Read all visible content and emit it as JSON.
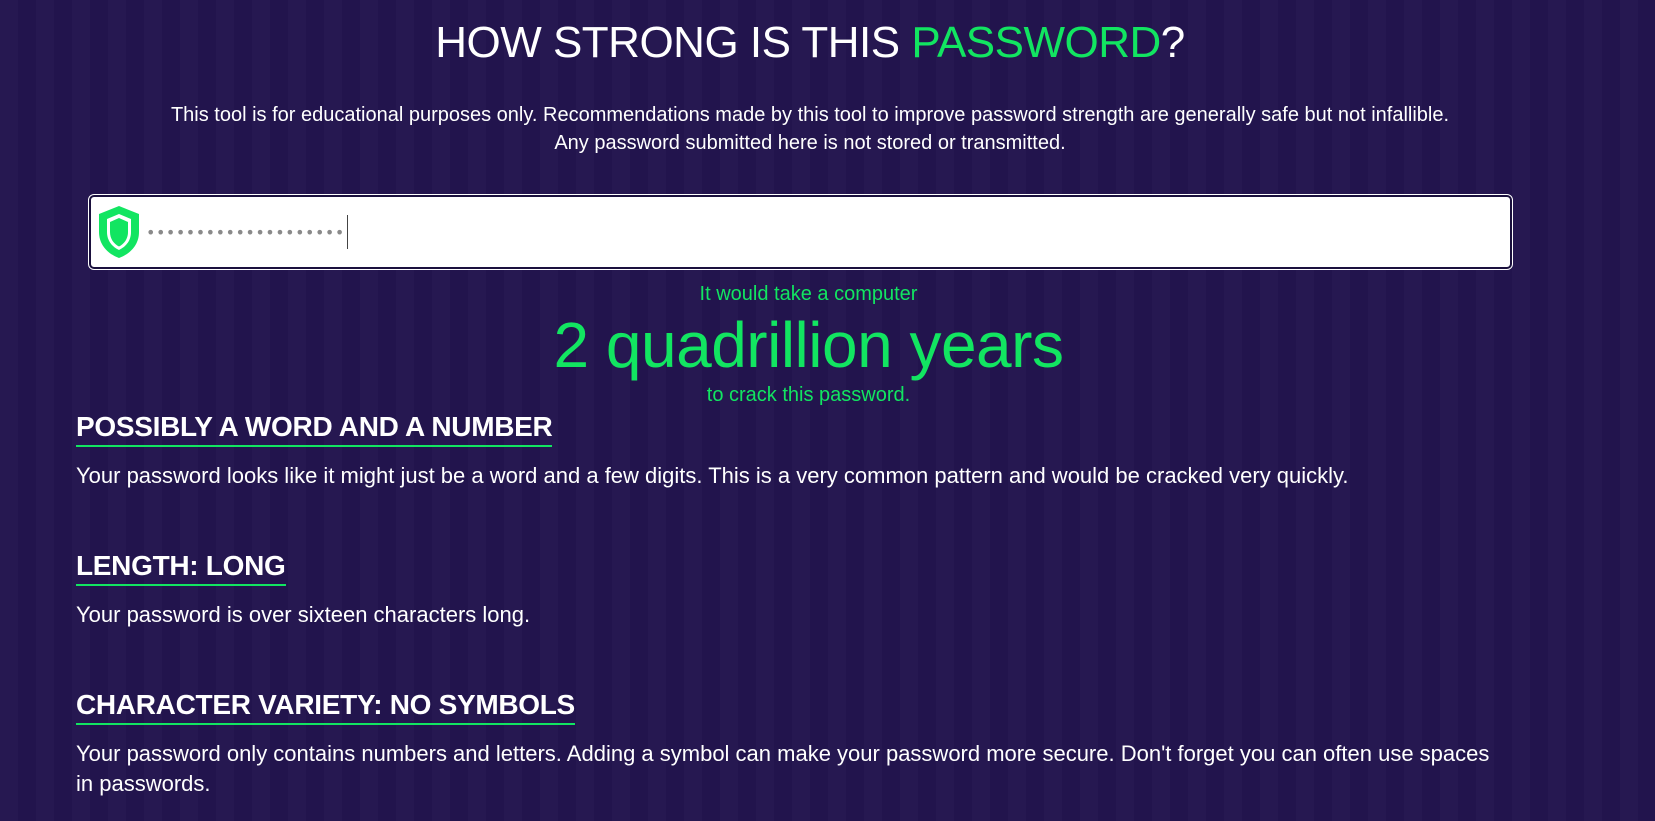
{
  "header": {
    "title_prefix": "HOW STRONG IS THIS ",
    "title_accent": "PASSWORD",
    "title_suffix": "?",
    "disclaimer_line1": "This tool is for educational purposes only. Recommendations made by this tool to improve password strength are generally safe but not infallible.",
    "disclaimer_line2": "Any password submitted here is not stored or transmitted."
  },
  "password_input": {
    "masked_value": "••••••••••••••••••••",
    "icon": "shield-icon"
  },
  "result": {
    "pre_text": "It would take a computer",
    "time": "2 quadrillion years",
    "post_text": "to crack this password."
  },
  "sections": [
    {
      "heading": "POSSIBLY A WORD AND A NUMBER",
      "body": "Your password looks like it might just be a word and a few digits. This is a very common pattern and would be cracked very quickly."
    },
    {
      "heading": "LENGTH: LONG",
      "body": "Your password is over sixteen characters long."
    },
    {
      "heading": "CHARACTER VARIETY: NO SYMBOLS",
      "body": "Your password only contains numbers and letters. Adding a symbol can make your password more secure. Don't forget you can often use spaces in passwords."
    }
  ],
  "colors": {
    "background": "#23154f",
    "accent": "#12e561",
    "text": "#ffffff"
  }
}
